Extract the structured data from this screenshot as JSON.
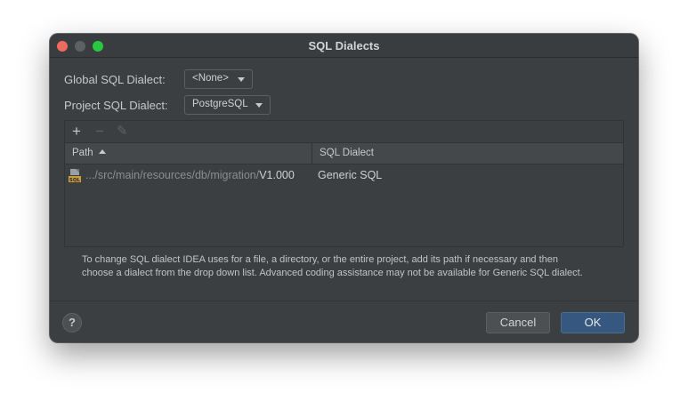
{
  "window": {
    "title": "SQL Dialects"
  },
  "global": {
    "label": "Global SQL Dialect:",
    "value": "<None>"
  },
  "project": {
    "label": "Project SQL Dialect:",
    "value": "PostgreSQL"
  },
  "toolbar": {
    "add": "+",
    "remove": "−",
    "edit": "✎"
  },
  "table": {
    "columns": [
      "Path",
      "SQL Dialect"
    ],
    "rows": [
      {
        "icon": "sql-file-icon",
        "path_prefix": ".../src/main/resources/db/migration/",
        "path_file": "V1.000",
        "dialect": "Generic SQL"
      }
    ]
  },
  "help_text": [
    "To change SQL dialect IDEA uses for a file, a directory, or the entire project, add its path if necessary and then",
    "choose a dialect from the drop down list. Advanced coding assistance may not be available for Generic SQL dialect."
  ],
  "footer": {
    "help": "?",
    "cancel": "Cancel",
    "ok": "OK"
  },
  "colors": {
    "background": "#3c3f41",
    "accent": "#365880",
    "traffic_close": "#ed6a5e",
    "traffic_max": "#28c940"
  }
}
